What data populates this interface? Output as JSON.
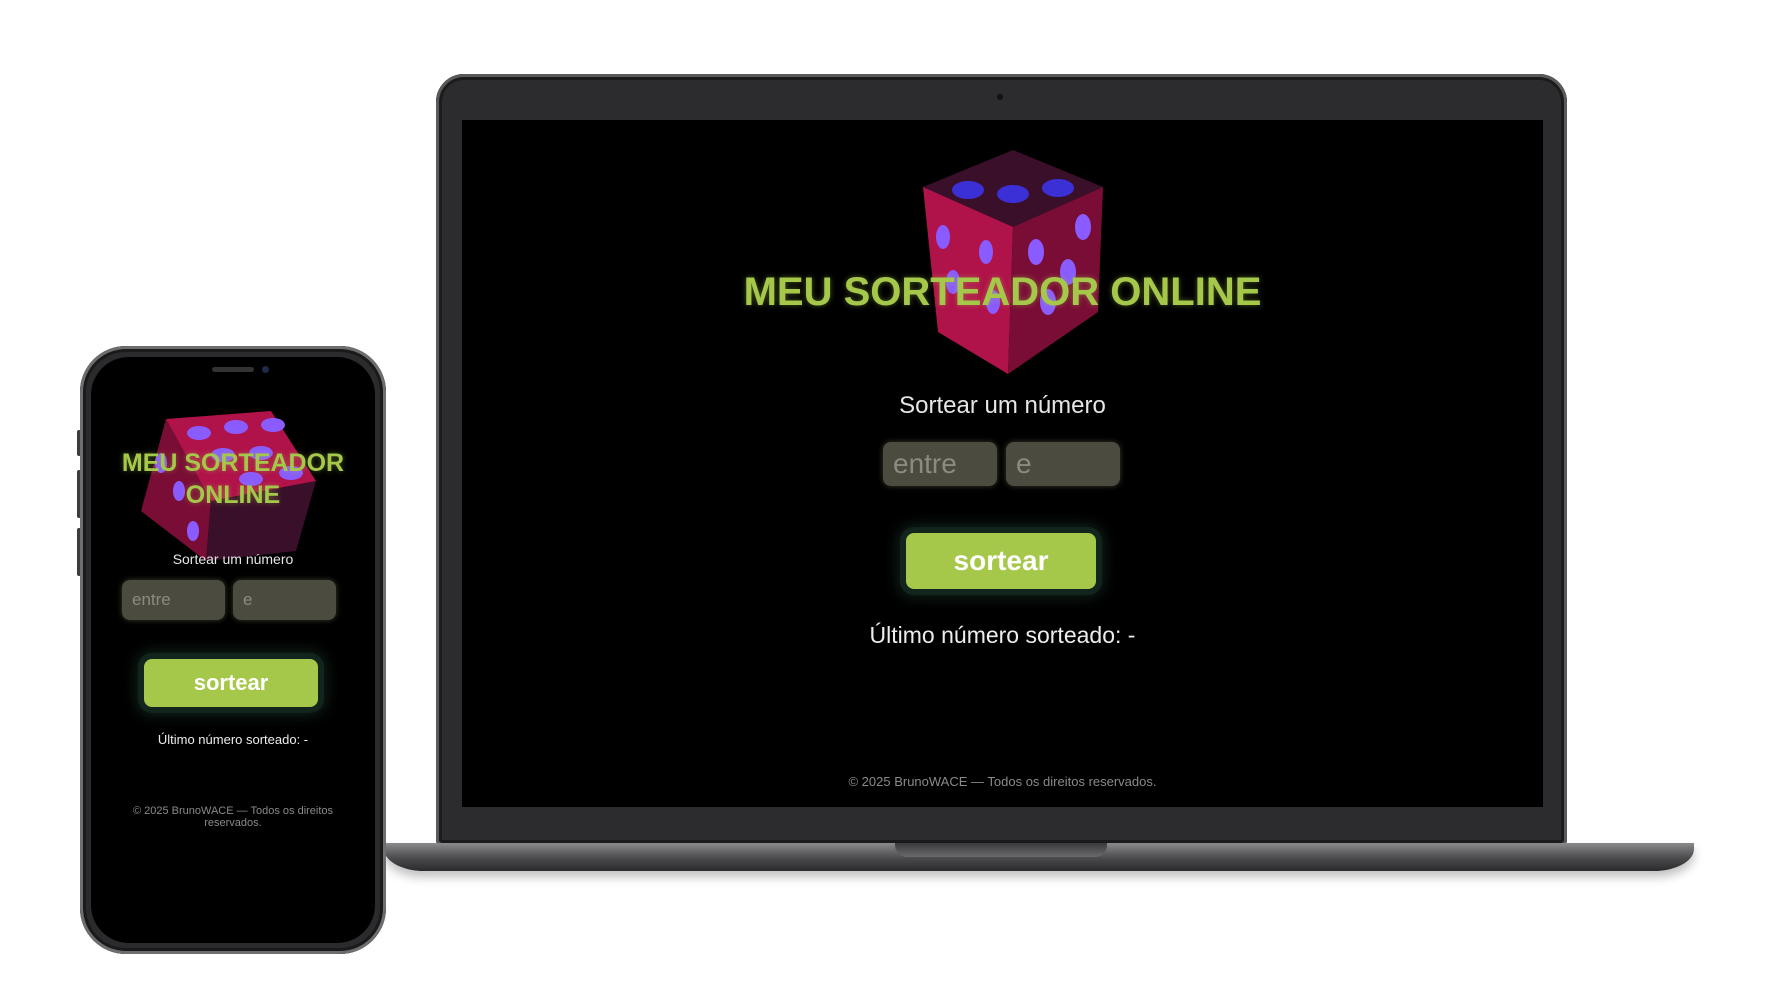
{
  "app": {
    "title": "MEU SORTEADOR ONLINE",
    "title_line1": "MEU SORTEADOR",
    "title_line2": "ONLINE",
    "section_label": "Sortear um número",
    "input_min_placeholder": "entre",
    "input_max_placeholder": "e",
    "draw_button_label": "sortear",
    "last_number_label": "Último número sorteado: -",
    "footer": "© 2025 BrunoWACE — Todos os direitos reservados.",
    "footer_line1": "© 2025 BrunoWACE — Todos os direitos",
    "footer_line2": "reservados."
  },
  "colors": {
    "title": "#a6c84a",
    "button": "#a6c84a",
    "dice_body": "#b0124a",
    "dice_pips": "#7b5cff",
    "background": "#000000"
  },
  "icons": {
    "dice": "dice-icon"
  }
}
